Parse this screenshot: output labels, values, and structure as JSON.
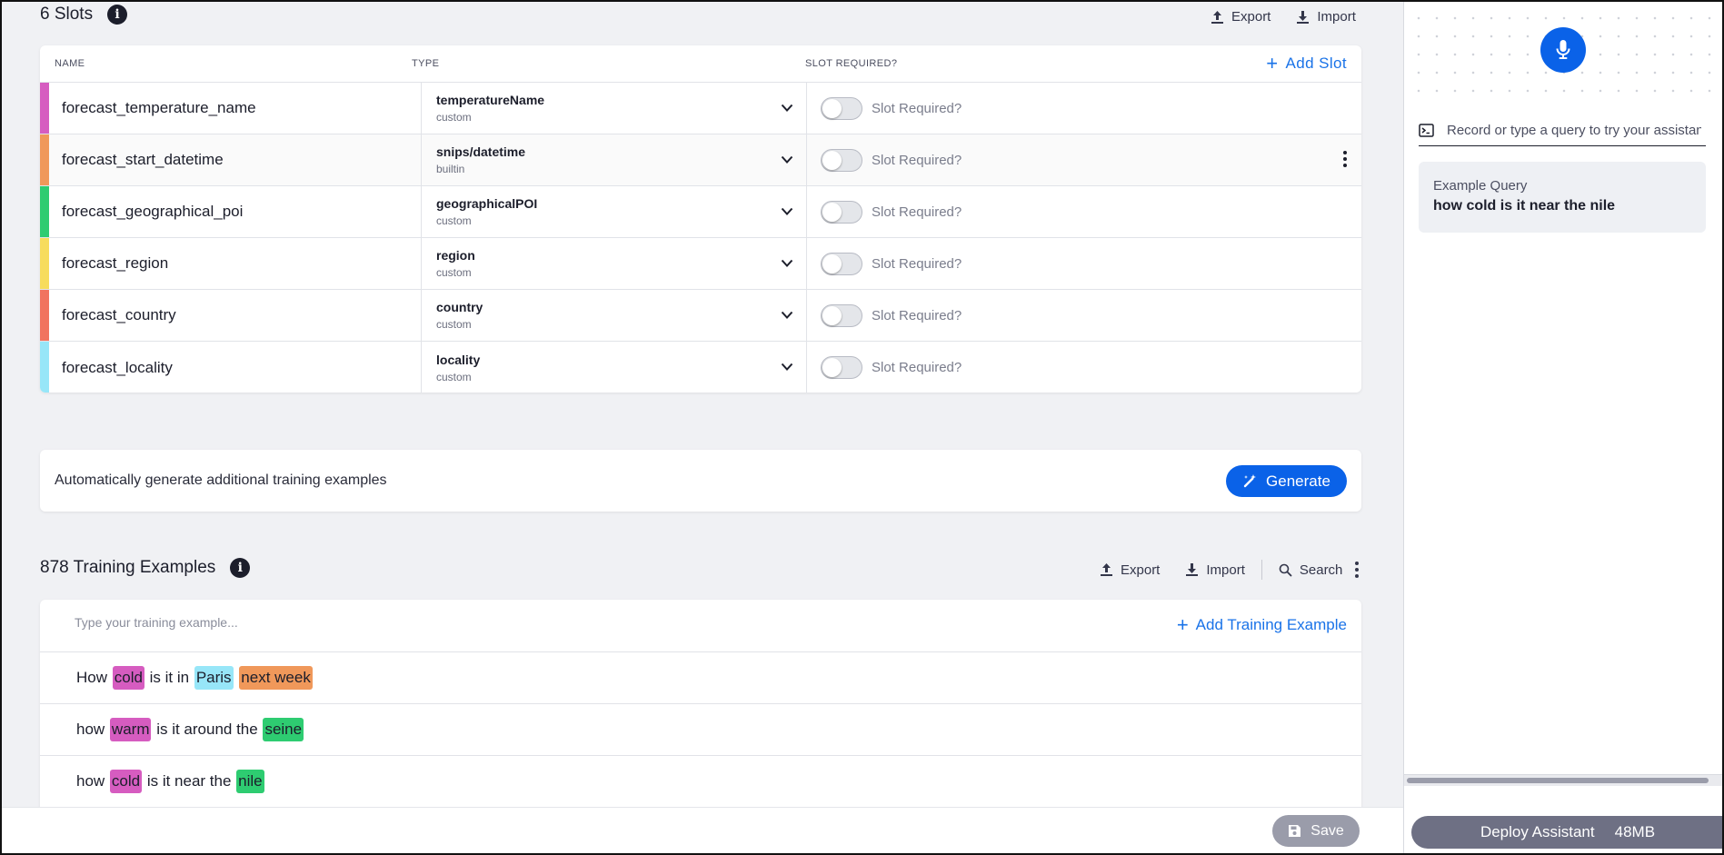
{
  "slots": {
    "title": "6 Slots",
    "export_label": "Export",
    "import_label": "Import",
    "headers": {
      "name": "NAME",
      "type": "TYPE",
      "required": "SLOT REQUIRED?"
    },
    "add_label": "Add Slot",
    "required_label": "Slot Required?",
    "rows": [
      {
        "name": "forecast_temperature_name",
        "type": "temperatureName",
        "source": "custom",
        "color": "#d65cc0",
        "required": false
      },
      {
        "name": "forecast_start_datetime",
        "type": "snips/datetime",
        "source": "builtin",
        "color": "#f0985a",
        "required": false
      },
      {
        "name": "forecast_geographical_poi",
        "type": "geographicalPOI",
        "source": "custom",
        "color": "#2ecc71",
        "required": false
      },
      {
        "name": "forecast_region",
        "type": "region",
        "source": "custom",
        "color": "#f7dc5c",
        "required": false
      },
      {
        "name": "forecast_country",
        "type": "country",
        "source": "custom",
        "color": "#f1735f",
        "required": false
      },
      {
        "name": "forecast_locality",
        "type": "locality",
        "source": "custom",
        "color": "#97e6f8",
        "required": false
      }
    ]
  },
  "generate": {
    "text": "Automatically generate additional training examples",
    "button_label": "Generate"
  },
  "training": {
    "title": "878 Training Examples",
    "export_label": "Export",
    "import_label": "Import",
    "search_label": "Search",
    "input_placeholder": "Type your training example...",
    "add_label": "Add Training Example",
    "examples": [
      [
        {
          "text": "How "
        },
        {
          "text": "cold",
          "color": "#d65cc0"
        },
        {
          "text": " is it in "
        },
        {
          "text": "Paris",
          "color": "#97e6f8"
        },
        {
          "text": " "
        },
        {
          "text": "next week",
          "color": "#f0985a"
        }
      ],
      [
        {
          "text": "how "
        },
        {
          "text": "warm",
          "color": "#d65cc0"
        },
        {
          "text": " is it around the "
        },
        {
          "text": "seine",
          "color": "#2ecc71"
        }
      ],
      [
        {
          "text": "how "
        },
        {
          "text": "cold",
          "color": "#d65cc0"
        },
        {
          "text": " is it near the "
        },
        {
          "text": "nile",
          "color": "#2ecc71"
        }
      ]
    ]
  },
  "footer": {
    "save_label": "Save"
  },
  "right_panel": {
    "query_placeholder": "Record or type a query to try your assistan",
    "example_label": "Example Query",
    "example_query": "how cold is it near the nile",
    "deploy_label": "Deploy Assistant",
    "deploy_size": "48MB"
  },
  "colors": {
    "accent": "#0a62e8",
    "link": "#1a73e8",
    "disabled": "#9a9caa"
  },
  "icons": {
    "info": "info-icon",
    "export": "upload-icon",
    "import": "download-icon",
    "search": "search-icon",
    "more": "kebab-icon",
    "chevron": "chevron-down-icon",
    "generate": "magic-wand-icon",
    "save": "floppy-disk-icon",
    "mic": "microphone-icon",
    "terminal": "terminal-icon"
  }
}
